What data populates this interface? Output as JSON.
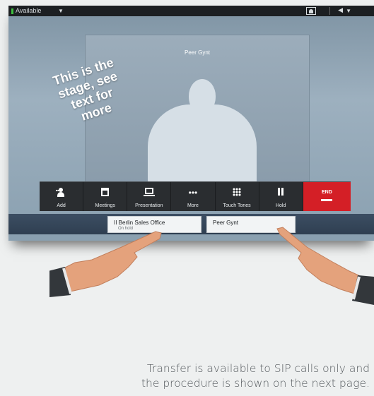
{
  "status_bar": {
    "availability": "Available",
    "availability_color": "#3fbf3f"
  },
  "stage": {
    "participant_name": "Peer Gynt"
  },
  "overlay": {
    "lines": [
      "This is the",
      "stage, see",
      "text for",
      "more"
    ]
  },
  "toolbar": {
    "buttons": [
      {
        "label": "Add",
        "icon": "add-person-icon"
      },
      {
        "label": "Meetings",
        "icon": "calendar-icon"
      },
      {
        "label": "Presentation",
        "icon": "laptop-icon"
      },
      {
        "label": "More",
        "icon": "ellipsis-icon"
      },
      {
        "label": "Touch Tones",
        "icon": "keypad-icon"
      },
      {
        "label": "Hold",
        "icon": "pause-icon"
      }
    ],
    "end_label": "END",
    "end_color": "#d41f26"
  },
  "calls": [
    {
      "name": "Berlin Sales Office",
      "status": "On hold",
      "icon": "pause-icon"
    },
    {
      "name": "Peer Gynt"
    }
  ],
  "caption": {
    "line1": "Transfer is available to SIP calls only and",
    "line2": "the procedure is shown on the next page."
  }
}
